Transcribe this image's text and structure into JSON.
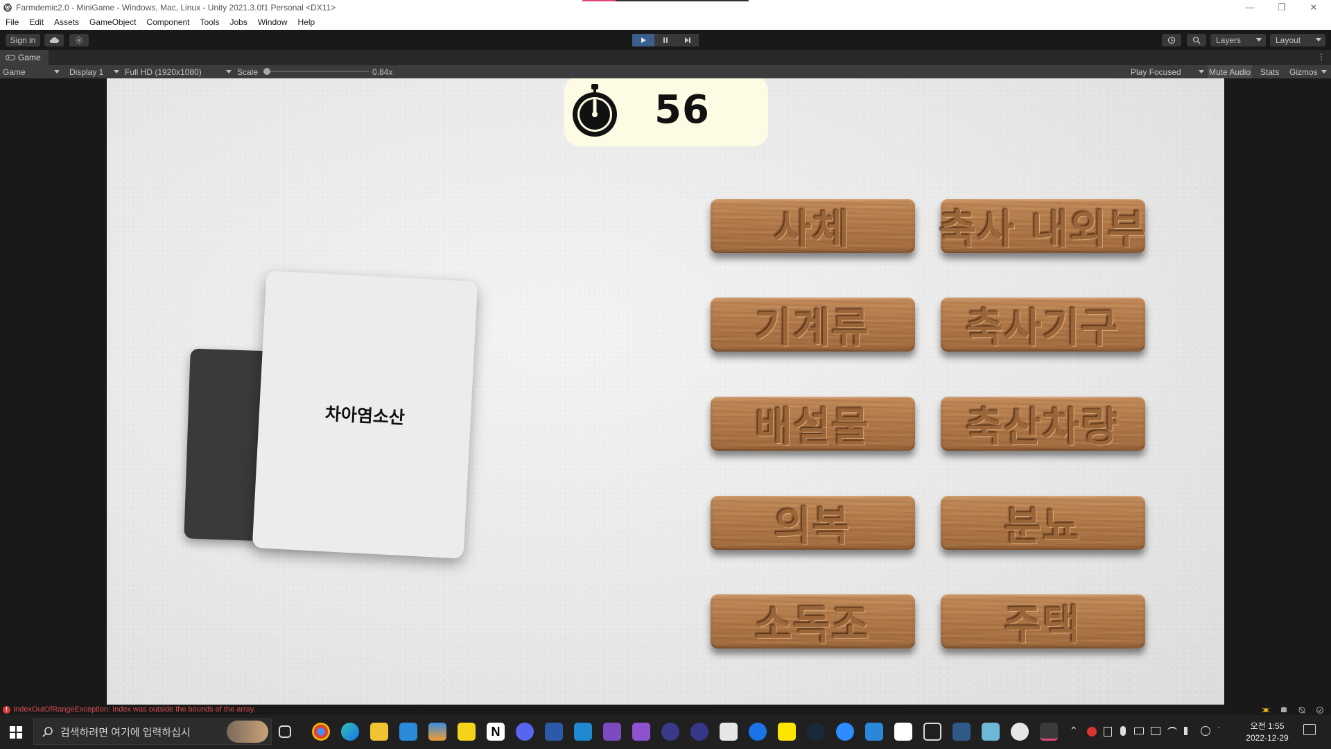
{
  "window": {
    "title": "Farmdemic2.0 - MiniGame - Windows, Mac, Linux - Unity 2021.3.0f1 Personal <DX11>"
  },
  "menu": [
    "File",
    "Edit",
    "Assets",
    "GameObject",
    "Component",
    "Tools",
    "Jobs",
    "Window",
    "Help"
  ],
  "toolbar": {
    "sign_in": "Sign in",
    "layers": "Layers",
    "layout": "Layout"
  },
  "game_tab": {
    "label": "Game"
  },
  "game_toolbar": {
    "view_mode": "Game",
    "display": "Display 1",
    "resolution": "Full HD (1920x1080)",
    "scale_label": "Scale",
    "scale_value": "0.84x",
    "play_focused": "Play Focused",
    "mute_audio": "Mute Audio",
    "stats": "Stats",
    "gizmos": "Gizmos"
  },
  "game": {
    "timer_value": "56",
    "card_text": "차아염소산",
    "options": [
      {
        "label": "사체"
      },
      {
        "label": "축사 내외부"
      },
      {
        "label": "기계류"
      },
      {
        "label": "축사기구"
      },
      {
        "label": "배설물"
      },
      {
        "label": "축산차량"
      },
      {
        "label": "의복"
      },
      {
        "label": "분뇨"
      },
      {
        "label": "소독조"
      },
      {
        "label": "주택"
      }
    ]
  },
  "status": {
    "error_message": "IndexOutOfRangeException: Index was outside the bounds of the array."
  },
  "taskbar": {
    "search_placeholder": "검색하려면 여기에 입력하십시",
    "time": "오전 1:55",
    "date": "2022-12-29"
  },
  "colors": {
    "accent": "#3b5f8c",
    "wood": "#b07747",
    "timer_bg": "#fdfbe3",
    "error": "#d84b4b"
  }
}
